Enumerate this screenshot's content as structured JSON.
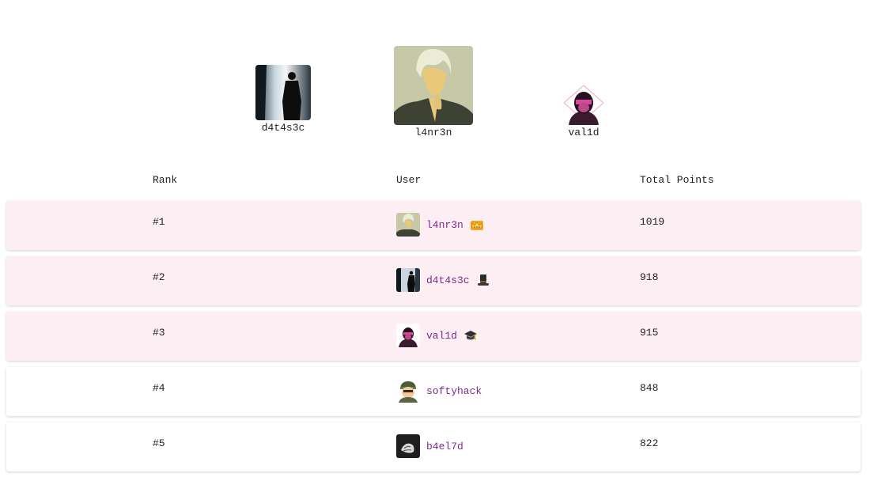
{
  "podium": {
    "first": {
      "name": "l4nr3n"
    },
    "second": {
      "name": "d4t4s3c"
    },
    "third": {
      "name": "val1d"
    }
  },
  "table": {
    "headers": {
      "rank": "Rank",
      "user": "User",
      "points": "Total Points"
    },
    "rows": [
      {
        "rank": "#1",
        "user": "l4nr3n",
        "points": "1019",
        "badge": "crown-icon",
        "highlight": true
      },
      {
        "rank": "#2",
        "user": "d4t4s3c",
        "points": "918",
        "badge": "top-hat-icon",
        "highlight": true
      },
      {
        "rank": "#3",
        "user": "val1d",
        "points": "915",
        "badge": "grad-cap-icon",
        "highlight": true
      },
      {
        "rank": "#4",
        "user": "softyhack",
        "points": "848",
        "badge": null,
        "highlight": false
      },
      {
        "rank": "#5",
        "user": "b4el7d",
        "points": "822",
        "badge": null,
        "highlight": false
      }
    ]
  },
  "colors": {
    "highlight_row": "#fdeef3",
    "username": "#7b2a8c"
  }
}
